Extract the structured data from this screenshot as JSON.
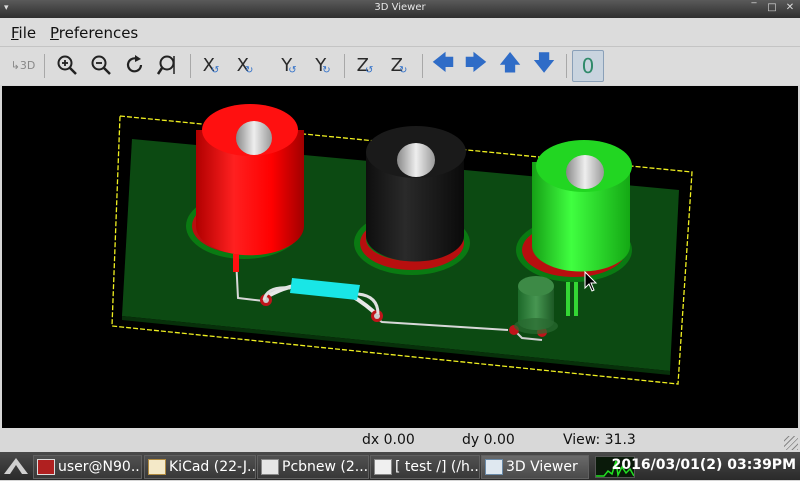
{
  "window": {
    "title": "3D Viewer"
  },
  "menubar": {
    "file": {
      "accel": "F",
      "rest": "ile"
    },
    "preferences": {
      "accel": "P",
      "rest": "references"
    }
  },
  "toolbar": {
    "reload": "3D",
    "x_label": "X",
    "y_label": "Y",
    "z_label": "Z",
    "ortho_label": "0"
  },
  "status": {
    "dx": "dx 0.00",
    "dy": "dy 0.00",
    "view": "View: 31.3"
  },
  "taskbar": {
    "tasks": [
      {
        "label": "user@N90..."
      },
      {
        "label": "KiCad (22-J..."
      },
      {
        "label": "Pcbnew (2..."
      },
      {
        "label": "[ test /] (/h..."
      },
      {
        "label": "3D Viewer"
      }
    ],
    "clock": "2016/03/01(2) 03:39PM"
  },
  "colors": {
    "pcb": "#0c4a12",
    "connector_red": "#ff1010",
    "connector_black": "#1a1a1a",
    "connector_green": "#22d622",
    "resistor": "#19e6e6",
    "edge_cuts": "#f0f020"
  }
}
